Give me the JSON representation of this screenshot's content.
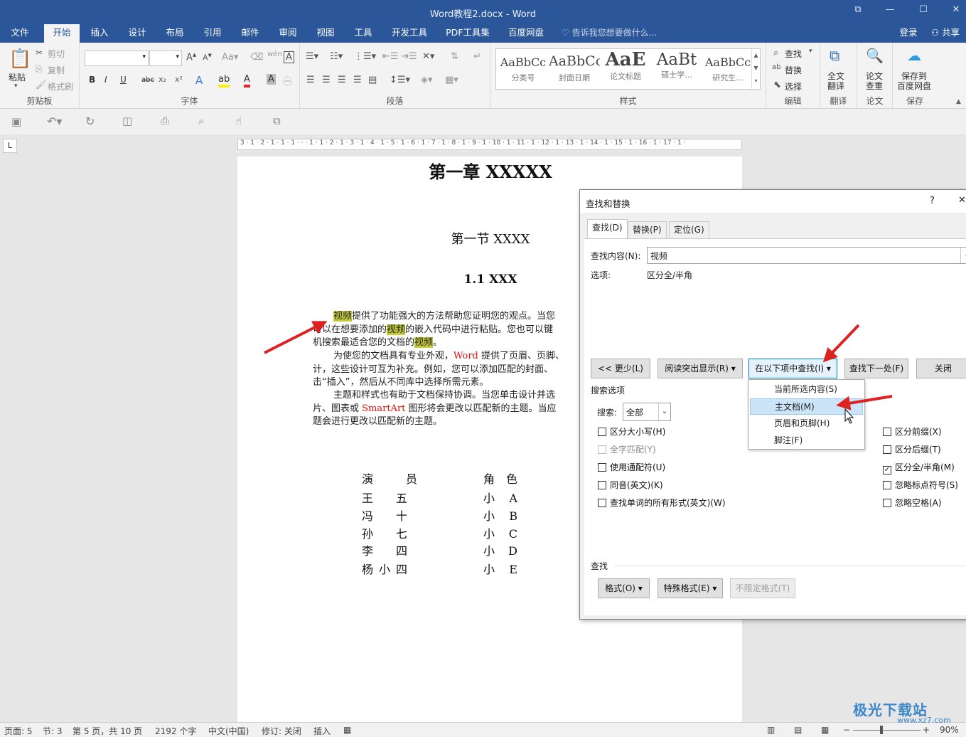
{
  "window": {
    "title": "Word教程2.docx - Word",
    "restore_icon": "⧉",
    "minimize": "—",
    "maximize": "☐",
    "close": "✕"
  },
  "tabs": [
    "文件",
    "开始",
    "插入",
    "设计",
    "布局",
    "引用",
    "邮件",
    "审阅",
    "视图",
    "工具",
    "开发工具",
    "PDF工具集",
    "百度网盘"
  ],
  "active_tab": "开始",
  "tell_me": "告诉我您想要做什么...",
  "login": "登录",
  "share": "共享",
  "ribbon": {
    "clipboard": {
      "label": "剪贴板",
      "paste": "粘贴",
      "cut": "剪切",
      "copy": "复制",
      "format_painter": "格式刷"
    },
    "font": {
      "label": "字体",
      "bold": "B",
      "italic": "I",
      "underline": "U",
      "strike": "abc"
    },
    "paragraph": {
      "label": "段落"
    },
    "styles": {
      "label": "样式",
      "items": [
        {
          "preview": "AaBbCc",
          "name": "分类号"
        },
        {
          "preview": "AaBbCc",
          "name": "封面日期"
        },
        {
          "preview": "AaE",
          "name": "论文标题"
        },
        {
          "preview": "AaBt",
          "name": "硕士学..."
        },
        {
          "preview": "AaBbCc",
          "name": "研究生..."
        }
      ]
    },
    "editing": {
      "label": "编辑",
      "find": "查找",
      "replace": "替换",
      "select": "选择"
    },
    "translate": {
      "label": "翻译",
      "full": "全文\n翻译"
    },
    "paper": {
      "label": "论文",
      "check": "论文\n查重"
    },
    "save": {
      "label": "保存",
      "baidu": "保存到\n百度网盘"
    }
  },
  "document": {
    "chapter": "第一章  XXXXX",
    "section": "第一节  XXXX",
    "subsection": "1.1 XXX",
    "p1": [
      {
        "t": "视频",
        "hl": true
      },
      {
        "t": "提供了功能强大的方法帮助您证明您的观点。当您"
      },
      {
        "br": true
      },
      {
        "t": "可以在想要添加的"
      },
      {
        "t": "视频",
        "hl": true
      },
      {
        "t": "的嵌入代码中进行粘贴。您也可以键"
      },
      {
        "br": true
      },
      {
        "t": "机搜索最适合您的文档的"
      },
      {
        "t": "视频",
        "hl": true
      },
      {
        "t": "。"
      }
    ],
    "p2a": "为使您的文档具有专业外观，",
    "p2_word": "Word",
    "p2b": " 提供了页眉、页脚、",
    "p2c": "计，这些设计可互为补充。例如，您可以添加匹配的封面、",
    "p2d": "击“插入”，然后从不同库中选择所需元素。",
    "p3a": "主题和样式也有助于文档保持协调。当您单击设计并选",
    "p3b": "片、图表或 ",
    "p3_smart": "SmartArt",
    "p3c": " 图形将会更改以匹配新的主题。当应",
    "p3d": "题会进行更改以匹配新的主题。",
    "table": {
      "headers": [
        "演  员",
        "角 色"
      ],
      "rows": [
        [
          "王  五",
          "小  A"
        ],
        [
          "冯  十",
          "小  B"
        ],
        [
          "孙  七",
          "小  C"
        ],
        [
          "李  四",
          "小  D"
        ],
        [
          "杨小四",
          "小  E"
        ]
      ]
    }
  },
  "dialog": {
    "title": "查找和替换",
    "help": "?",
    "close_x": "✕",
    "tabs": [
      "查找(D)",
      "替换(P)",
      "定位(G)"
    ],
    "find_label": "查找内容(N):",
    "find_value": "视频",
    "options_label": "选项:",
    "options_value": "区分全/半角",
    "btn_less": "<< 更少(L)",
    "btn_highlight": "阅读突出显示(R) ▾",
    "btn_findin": "在以下项中查找(I) ▾",
    "btn_next": "查找下一处(F)",
    "btn_close": "关闭",
    "search_options": "搜索选项",
    "search_label": "搜索:",
    "search_value": "全部",
    "left_checks": [
      {
        "label": "区分大小写(H)",
        "checked": false,
        "disabled": false
      },
      {
        "label": "全字匹配(Y)",
        "checked": false,
        "disabled": true
      },
      {
        "label": "使用通配符(U)",
        "checked": false,
        "disabled": false
      },
      {
        "label": "同音(英文)(K)",
        "checked": false,
        "disabled": false
      },
      {
        "label": "查找单词的所有形式(英文)(W)",
        "checked": false,
        "disabled": false
      }
    ],
    "right_checks": [
      {
        "label": "区分前缀(X)",
        "checked": false
      },
      {
        "label": "区分后缀(T)",
        "checked": false
      },
      {
        "label": "区分全/半角(M)",
        "checked": true
      },
      {
        "label": "忽略标点符号(S)",
        "checked": false
      },
      {
        "label": "忽略空格(A)",
        "checked": false
      }
    ],
    "find_section": "查找",
    "btn_format": "格式(O) ▾",
    "btn_special": "特殊格式(E) ▾",
    "btn_noformat": "不限定格式(T)"
  },
  "dropdown": [
    "当前所选内容(S)",
    "主文档(M)",
    "页眉和页脚(H)",
    "脚注(F)"
  ],
  "dropdown_hover": 1,
  "status": {
    "page": "页面: 5",
    "section": "节: 3",
    "pages": "第 5 页，共 10 页",
    "words": "2192 个字",
    "lang": "中文(中国)",
    "track": "修订: 关闭",
    "insert": "插入",
    "zoom": "90%"
  },
  "watermark": {
    "brand": "极光下载站",
    "url": "www.xz7.com"
  },
  "accent": "#2b579a",
  "arrow_color": "#d22"
}
